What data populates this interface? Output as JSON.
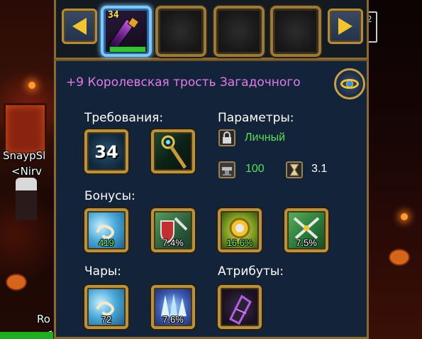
{
  "background": {
    "name_left_1": "SnaypSl",
    "name_left_2": "<Nirv",
    "name_left_3": "Ro",
    "name_left_4": "<",
    "crest_text": "2"
  },
  "top_bar": {
    "selected_slot_level": "34",
    "selected_slot_bar_fill": 1.0
  },
  "item": {
    "title": "+9 Королевская трость Загадочного",
    "title_color": "#e37be8"
  },
  "requirements": {
    "label": "Требования:",
    "level": "34"
  },
  "params": {
    "label": "Параметры:",
    "binding": "Личный",
    "binding_color": "#55e05a",
    "durability": "100",
    "speed": "3.1"
  },
  "bonuses": {
    "label": "Бонусы:",
    "items": [
      {
        "icon": "wind-swirl-icon",
        "value": "419"
      },
      {
        "icon": "shield-sword-icon",
        "value": "7.4%"
      },
      {
        "icon": "gold-coin-icon",
        "value": "16.6%"
      },
      {
        "icon": "crossed-swords-icon",
        "value": "7.5%"
      }
    ]
  },
  "enchants": {
    "label": "Чары:",
    "items": [
      {
        "icon": "wind-swirl-icon",
        "value": "72"
      },
      {
        "icon": "ice-crystals-icon",
        "value": "7.6%"
      }
    ]
  },
  "attributes": {
    "label": "Атрибуты:",
    "items": [
      {
        "icon": "dark-gauntlet-icon",
        "value": ""
      }
    ]
  }
}
